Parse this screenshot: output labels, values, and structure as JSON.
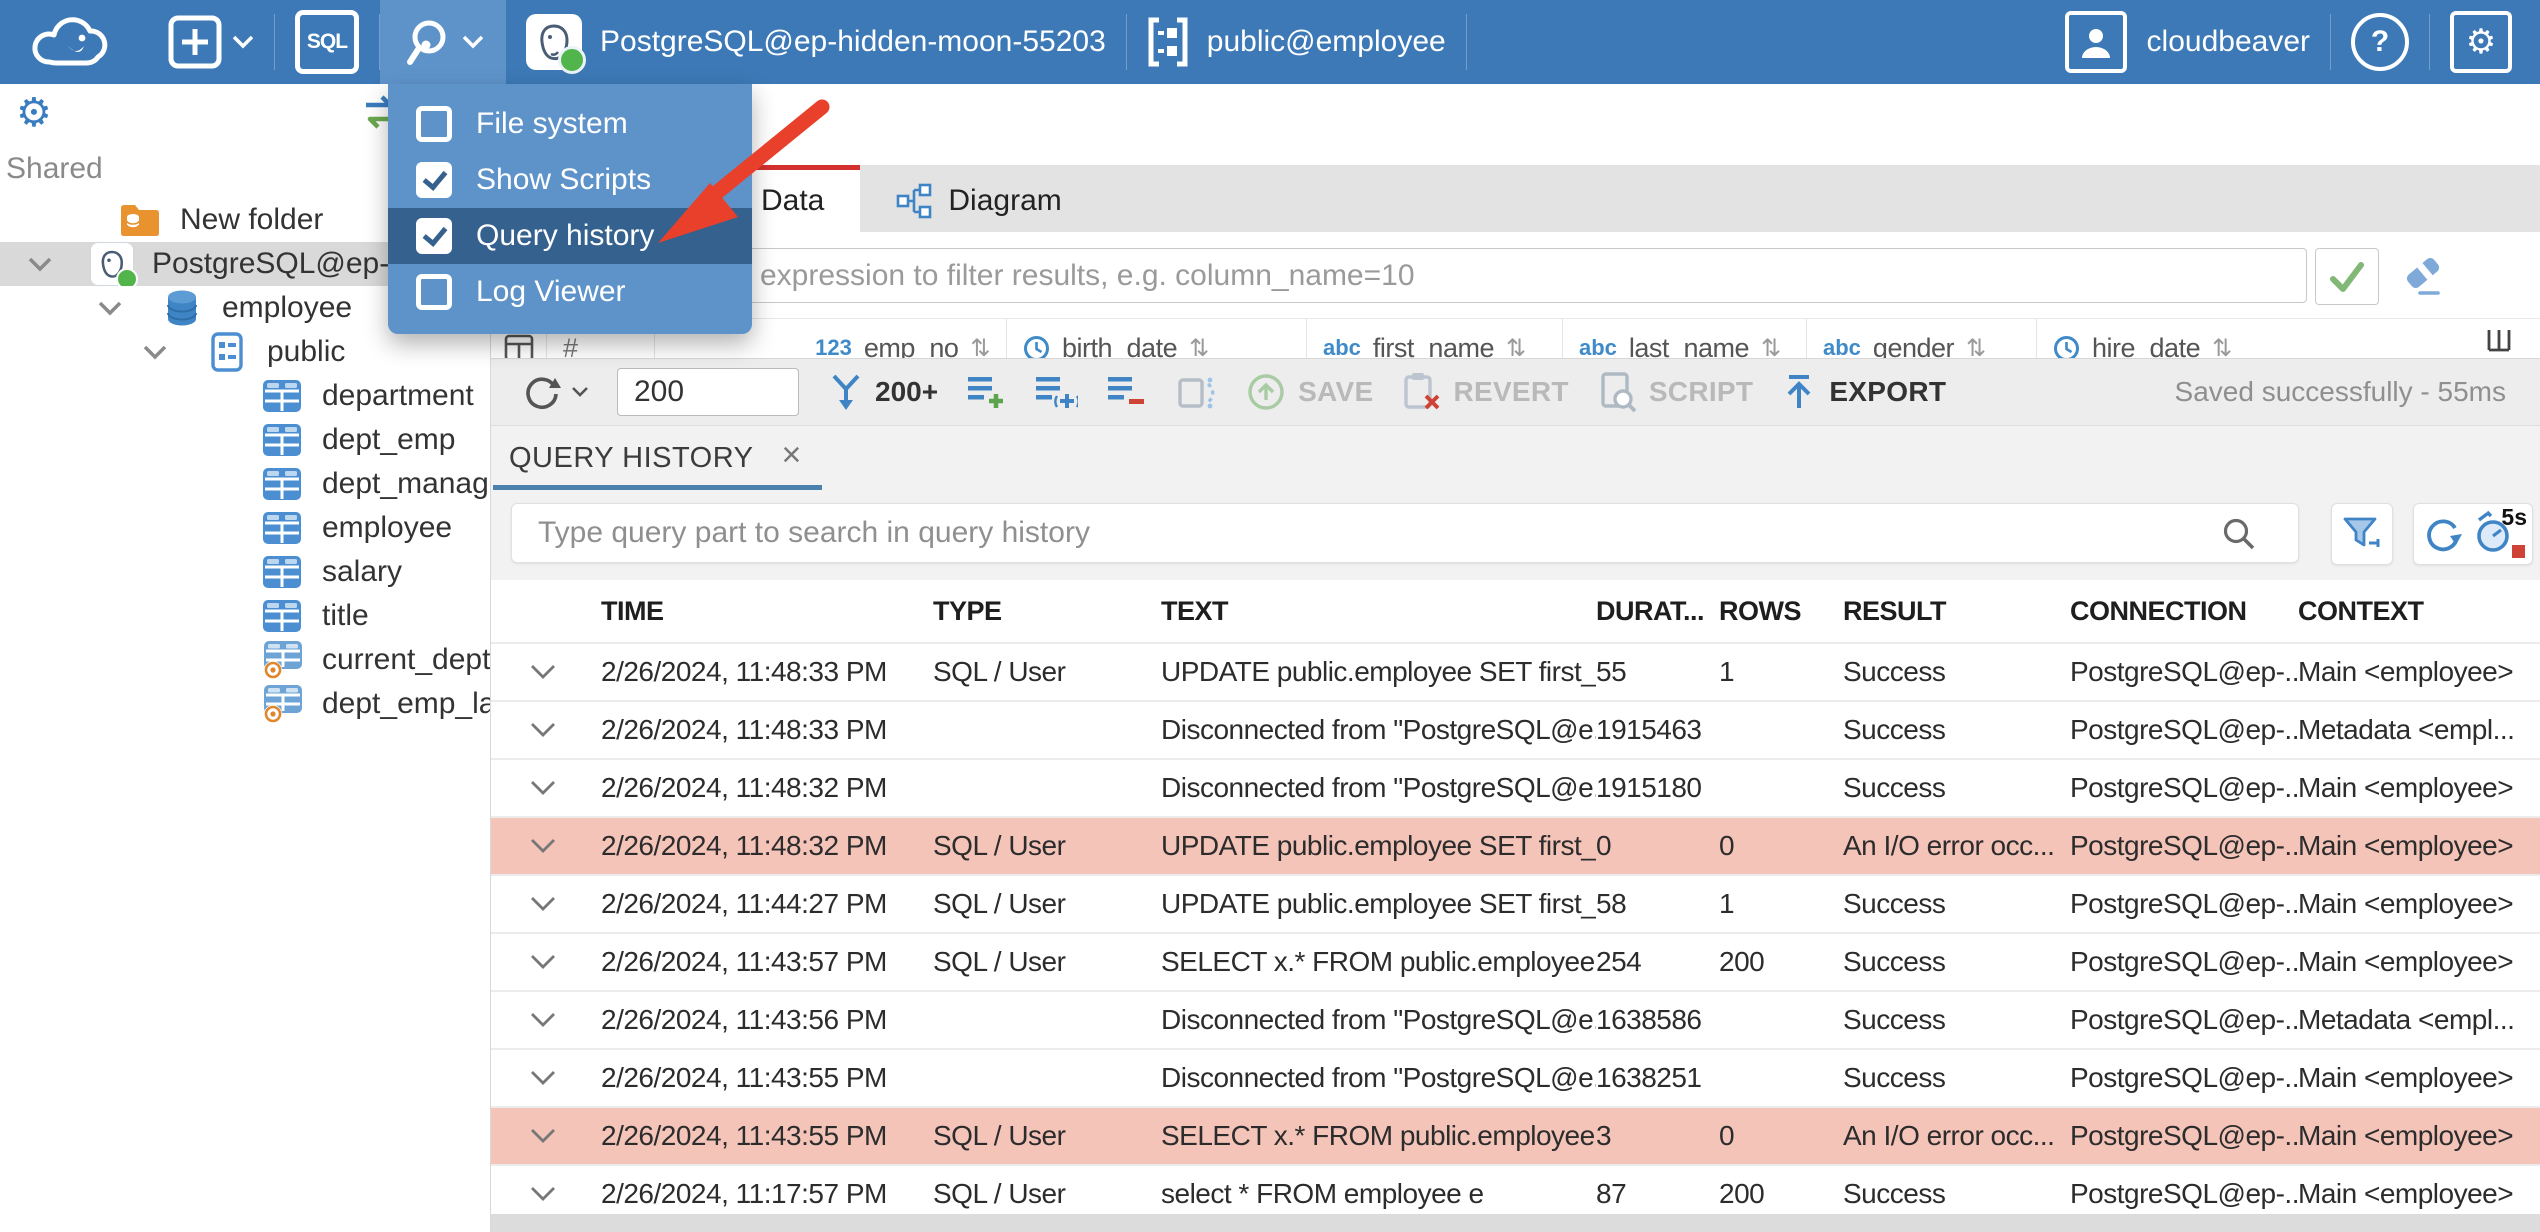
{
  "colors": {
    "topbar_blue": "#3c79b6",
    "menu_blue": "#5e93ca",
    "menu_highlight": "#35618e",
    "active_tab_red": "#d3302f",
    "error_row_pink": "#f4c4b9",
    "icon_blue": "#3f85c6"
  },
  "header": {
    "sql_badge": "SQL",
    "connection_name": "PostgreSQL@ep-hidden-moon-55203",
    "schema_name": "public@employee",
    "username": "cloudbeaver",
    "help_glyph": "?"
  },
  "tools_menu": {
    "items": [
      {
        "label": "File system",
        "checked": false,
        "highlighted": false
      },
      {
        "label": "Show Scripts",
        "checked": true,
        "highlighted": false
      },
      {
        "label": "Query history",
        "checked": true,
        "highlighted": true
      },
      {
        "label": "Log Viewer",
        "checked": false,
        "highlighted": false
      }
    ]
  },
  "sidebar": {
    "section_label": "Shared",
    "tree": [
      {
        "label": "New folder",
        "icon": "folder",
        "indent": 48,
        "expanded": false,
        "selected": false
      },
      {
        "label": "PostgreSQL@ep-hidden-",
        "icon": "postgres",
        "indent": 20,
        "expanded": true,
        "selected": true
      },
      {
        "label": "employee",
        "icon": "database",
        "indent": 90,
        "expanded": true,
        "selected": false
      },
      {
        "label": "public",
        "icon": "schema",
        "indent": 135,
        "expanded": true,
        "selected": false
      },
      {
        "label": "department",
        "icon": "table",
        "indent": 190,
        "expanded": false,
        "selected": false
      },
      {
        "label": "dept_emp",
        "icon": "table",
        "indent": 190,
        "expanded": false,
        "selected": false
      },
      {
        "label": "dept_manager",
        "icon": "table",
        "indent": 190,
        "expanded": false,
        "selected": false
      },
      {
        "label": "employee",
        "icon": "table",
        "indent": 190,
        "expanded": false,
        "selected": false
      },
      {
        "label": "salary",
        "icon": "table",
        "indent": 190,
        "expanded": false,
        "selected": false
      },
      {
        "label": "title",
        "icon": "table",
        "indent": 190,
        "expanded": false,
        "selected": false
      },
      {
        "label": "current_dept_emp",
        "icon": "view",
        "indent": 190,
        "expanded": false,
        "selected": false
      },
      {
        "label": "dept_emp_latest_date",
        "icon": "view",
        "indent": 190,
        "expanded": false,
        "selected": false
      }
    ]
  },
  "data_editor": {
    "tabs": [
      {
        "label": "Data",
        "active": true
      },
      {
        "label": "Diagram",
        "active": false,
        "icon": "diagram"
      }
    ],
    "filter_placeholder": "expression to filter results, e.g. column_name=10",
    "row_number_header": "#",
    "grid_columns": [
      {
        "name": "emp_no",
        "type": "num"
      },
      {
        "name": "birth_date",
        "type": "date"
      },
      {
        "name": "first_name",
        "type": "text"
      },
      {
        "name": "last_name",
        "type": "text"
      },
      {
        "name": "gender",
        "type": "text"
      },
      {
        "name": "hire_date",
        "type": "date"
      }
    ],
    "sort_glyph": "⇅",
    "toolbar": {
      "row_limit": "200",
      "fetch_size": "200+",
      "save_label": "SAVE",
      "revert_label": "REVERT",
      "script_label": "SCRIPT",
      "export_label": "EXPORT",
      "status": "Saved successfully - 55ms"
    }
  },
  "query_history": {
    "tab_label": "QUERY HISTORY",
    "close_glyph": "×",
    "search_placeholder": "Type query part to search in query history",
    "refresh_interval": "5s",
    "columns": [
      "TIME",
      "TYPE",
      "TEXT",
      "DURAT...",
      "ROWS",
      "RESULT",
      "CONNECTION",
      "CONTEXT"
    ],
    "rows": [
      {
        "time": "2/26/2024, 11:48:33 PM",
        "type": "SQL / User",
        "text": "UPDATE public.employee SET first_...",
        "duration": "55",
        "rows": "1",
        "result": "Success",
        "connection": "PostgreSQL@ep-...",
        "context": "Main <employee>",
        "error": false
      },
      {
        "time": "2/26/2024, 11:48:33 PM",
        "type": "",
        "text": "Disconnected from \"PostgreSQL@e...",
        "duration": "1915463",
        "rows": "",
        "result": "Success",
        "connection": "PostgreSQL@ep-...",
        "context": "Metadata <empl...",
        "error": false
      },
      {
        "time": "2/26/2024, 11:48:32 PM",
        "type": "",
        "text": "Disconnected from \"PostgreSQL@e...",
        "duration": "1915180",
        "rows": "",
        "result": "Success",
        "connection": "PostgreSQL@ep-...",
        "context": "Main <employee>",
        "error": false
      },
      {
        "time": "2/26/2024, 11:48:32 PM",
        "type": "SQL / User",
        "text": "UPDATE public.employee SET first_...",
        "duration": "0",
        "rows": "0",
        "result": "An I/O error occ...",
        "connection": "PostgreSQL@ep-...",
        "context": "Main <employee>",
        "error": true
      },
      {
        "time": "2/26/2024, 11:44:27 PM",
        "type": "SQL / User",
        "text": "UPDATE public.employee SET first_...",
        "duration": "58",
        "rows": "1",
        "result": "Success",
        "connection": "PostgreSQL@ep-...",
        "context": "Main <employee>",
        "error": false
      },
      {
        "time": "2/26/2024, 11:43:57 PM",
        "type": "SQL / User",
        "text": "SELECT x.* FROM public.employee x",
        "duration": "254",
        "rows": "200",
        "result": "Success",
        "connection": "PostgreSQL@ep-...",
        "context": "Main <employee>",
        "error": false
      },
      {
        "time": "2/26/2024, 11:43:56 PM",
        "type": "",
        "text": "Disconnected from \"PostgreSQL@e...",
        "duration": "1638586",
        "rows": "",
        "result": "Success",
        "connection": "PostgreSQL@ep-...",
        "context": "Metadata <empl...",
        "error": false
      },
      {
        "time": "2/26/2024, 11:43:55 PM",
        "type": "",
        "text": "Disconnected from \"PostgreSQL@e...",
        "duration": "1638251",
        "rows": "",
        "result": "Success",
        "connection": "PostgreSQL@ep-...",
        "context": "Main <employee>",
        "error": false
      },
      {
        "time": "2/26/2024, 11:43:55 PM",
        "type": "SQL / User",
        "text": "SELECT x.* FROM public.employee x",
        "duration": "3",
        "rows": "0",
        "result": "An I/O error occ...",
        "connection": "PostgreSQL@ep-...",
        "context": "Main <employee>",
        "error": true
      },
      {
        "time": "2/26/2024, 11:17:57 PM",
        "type": "SQL / User",
        "text": "select * FROM employee e",
        "duration": "87",
        "rows": "200",
        "result": "Success",
        "connection": "PostgreSQL@ep-...",
        "context": "Main <employee>",
        "error": false
      }
    ]
  }
}
